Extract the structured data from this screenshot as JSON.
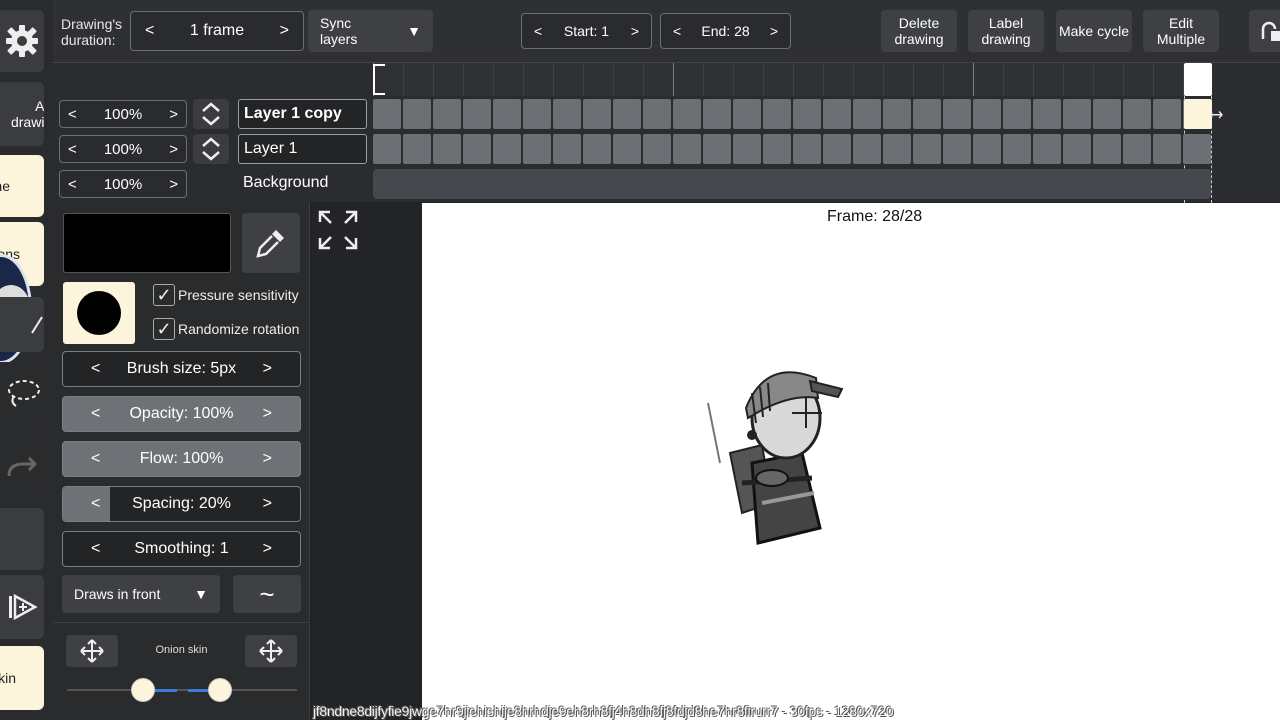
{
  "left_toolbar": {
    "add_drawing": "Add drawing",
    "partial_item_1": "ne",
    "partial_item_2": "ons",
    "partial_item_3": "kin"
  },
  "top_toolbar": {
    "duration_label": "Drawing's duration:",
    "duration_value": "1 frame",
    "sync_layers": "Sync layers",
    "start_label": "Start:",
    "start_value": "1",
    "end_label": "End:",
    "end_value": "28",
    "delete_drawing": "Delete drawing",
    "label_drawing": "Label drawing",
    "make_cycle": "Make cycle",
    "edit_multiple": "Edit Multiple"
  },
  "layers": [
    {
      "name": "Layer 1 copy",
      "zoom": "100%"
    },
    {
      "name": "Layer 1",
      "zoom": "100%"
    },
    {
      "name": "Background",
      "zoom": "100%"
    }
  ],
  "brush": {
    "pressure_sensitivity": "Pressure sensitivity",
    "pressure_checked": true,
    "randomize_rotation": "Randomize rotation",
    "randomize_checked": true,
    "brush_size": "Brush size:  5px",
    "opacity": "Opacity:  100%",
    "flow": "Flow:  100%",
    "spacing": "Spacing:  20%",
    "spacing_fraction": 0.2,
    "smoothing": "Smoothing:  1",
    "draw_mode": "Draws in front",
    "color": "#000000"
  },
  "onion": {
    "label": "Onion skin",
    "accent": "#3e7bd9"
  },
  "canvas": {
    "frame_label": "Frame: 28/28",
    "current_frame": 28,
    "total_frames": 28
  },
  "caption": "jf8ndne8dijfyfie9jwge7hr9jiehishije8hrhdje9eh8rh8fj4h8dh8fj8fdjd8he7hr8firurr7 - 30fps - 1280x720",
  "arrows": {
    "left": "<",
    "right": ">"
  }
}
